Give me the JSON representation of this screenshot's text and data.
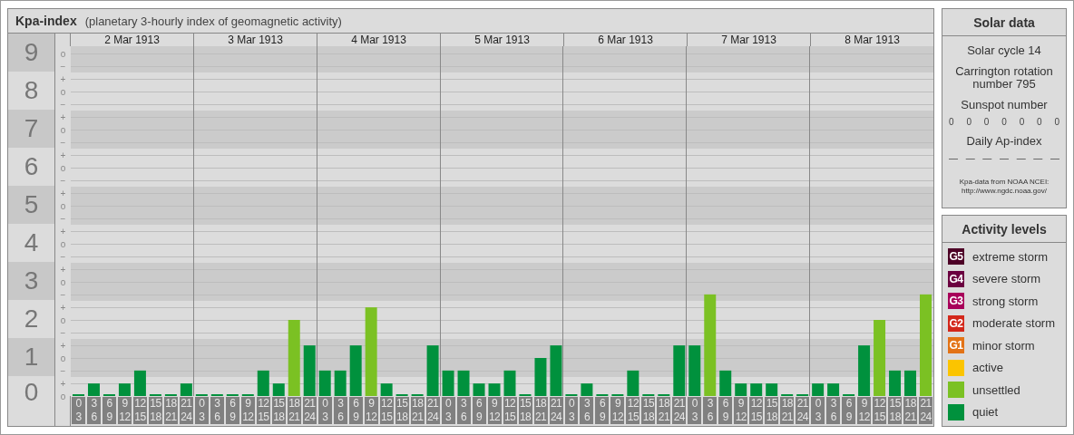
{
  "kp_panel": {
    "title": "Kpa-index",
    "subtitle": "(planetary 3-hourly index of geomagnetic activity)",
    "day_labels": [
      "2 Mar 1913",
      "3 Mar 1913",
      "4 Mar 1913",
      "5 Mar 1913",
      "6 Mar 1913",
      "7 Mar 1913",
      "8 Mar 1913"
    ],
    "ytick_marks": [
      "o",
      "−",
      "+",
      "o",
      "−",
      "+",
      "o",
      "−",
      "+",
      "o",
      "−",
      "+",
      "o",
      "−",
      "+",
      "o",
      "−",
      "+",
      "o",
      "−",
      "+",
      "o",
      "−",
      "+",
      "o",
      "−",
      "+",
      "o"
    ],
    "chart_data": {
      "type": "bar",
      "ylim": [
        0,
        9.2
      ],
      "grid": true,
      "yticks": [
        {
          "value": 0,
          "label": "0"
        },
        {
          "value": 1,
          "label": "1"
        },
        {
          "value": 2,
          "label": "2"
        },
        {
          "value": 3,
          "label": "3"
        },
        {
          "value": 4,
          "label": "4"
        },
        {
          "value": 5,
          "label": "5"
        },
        {
          "value": 6,
          "label": "6"
        },
        {
          "value": 7,
          "label": "7"
        },
        {
          "value": 8,
          "label": "8"
        },
        {
          "value": 9,
          "label": "9"
        }
      ],
      "categories": [
        "0 3",
        "3 6",
        "6 9",
        "9 12",
        "12 15",
        "15 18",
        "18 21",
        "21 24",
        "0 3",
        "3 6",
        "6 9",
        "9 12",
        "12 15",
        "15 18",
        "18 21",
        "21 24",
        "0 3",
        "3 6",
        "6 9",
        "9 12",
        "12 15",
        "15 18",
        "18 21",
        "21 24",
        "0 3",
        "3 6",
        "6 9",
        "9 12",
        "12 15",
        "15 18",
        "18 21",
        "21 24",
        "0 3",
        "3 6",
        "6 9",
        "9 12",
        "12 15",
        "15 18",
        "18 21",
        "21 24",
        "0 3",
        "3 6",
        "6 9",
        "9 12",
        "12 15",
        "15 18",
        "18 21",
        "21 24",
        "0 3",
        "3 6",
        "6 9",
        "9 12",
        "12 15",
        "15 18",
        "18 21",
        "21 24"
      ],
      "series": [
        {
          "color": "#00913d",
          "values": [
            0,
            0.33,
            0,
            0.33,
            0.67,
            0,
            0,
            0.33,
            0,
            0,
            0,
            0,
            0.67,
            0.33,
            null,
            1.33,
            0.67,
            0.67,
            1.33,
            null,
            0.33,
            0,
            0,
            1.33,
            0.67,
            0.67,
            0.33,
            0.33,
            0.67,
            0,
            1,
            1.33,
            0,
            0.33,
            0,
            0,
            0.67,
            0,
            0,
            1.33,
            1.33,
            null,
            0.67,
            0.33,
            0.33,
            0.33,
            0,
            0,
            0.33,
            0.33,
            0,
            1.33,
            null,
            0.67,
            0.67,
            null
          ]
        },
        {
          "color": "#7bc123",
          "values": [
            null,
            null,
            null,
            null,
            null,
            null,
            null,
            null,
            null,
            null,
            null,
            null,
            null,
            null,
            2,
            null,
            null,
            null,
            null,
            2.33,
            null,
            null,
            null,
            null,
            null,
            null,
            null,
            null,
            null,
            null,
            null,
            null,
            null,
            null,
            null,
            null,
            null,
            null,
            null,
            null,
            null,
            2.67,
            null,
            null,
            null,
            null,
            null,
            null,
            null,
            null,
            null,
            null,
            2,
            null,
            null,
            2.67
          ]
        }
      ]
    }
  },
  "solar_data": {
    "title": "Solar data",
    "solar_cycle": "Solar cycle 14",
    "carrington": "Carrington rotation number 795",
    "sunspot_title": "Sunspot number",
    "sunspot_values": [
      "0",
      "0",
      "0",
      "0",
      "0",
      "0",
      "0"
    ],
    "ap_title": "Daily Ap-index",
    "ap_values": [
      "—",
      "—",
      "—",
      "—",
      "—",
      "—",
      "—"
    ],
    "source": "Kpa-data from NOAA NCEI: http://www.ngdc.noaa.gov/"
  },
  "activity_levels": {
    "title": "Activity levels",
    "items": [
      {
        "badge": "G5",
        "label": "extreme storm",
        "color": "#4d0026"
      },
      {
        "badge": "G4",
        "label": "severe storm",
        "color": "#6b0040"
      },
      {
        "badge": "G3",
        "label": "strong storm",
        "color": "#a8005a"
      },
      {
        "badge": "G2",
        "label": "moderate storm",
        "color": "#d3271a"
      },
      {
        "badge": "G1",
        "label": "minor storm",
        "color": "#e37316"
      },
      {
        "label": "active",
        "color": "#fbc400"
      },
      {
        "label": "unsettled",
        "color": "#7bc123"
      },
      {
        "label": "quiet",
        "color": "#00913d"
      }
    ]
  }
}
